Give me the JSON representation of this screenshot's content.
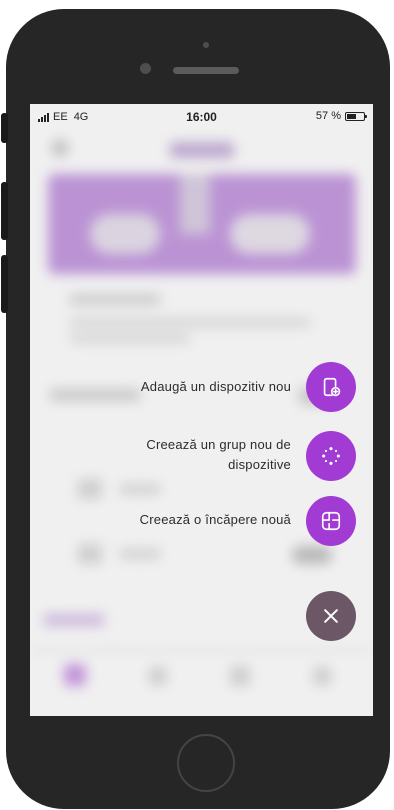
{
  "status_bar": {
    "carrier": "EE",
    "network": "4G",
    "time": "16:00",
    "battery_text": "57 %",
    "battery_level": 0.57
  },
  "speed_dial": {
    "add_device_label": "Adaugă un dispozitiv nou",
    "create_group_label_line1": "Creează un grup nou de",
    "create_group_label_line2": "dispozitive",
    "create_room_label": "Creează o încăpere nouă"
  },
  "colors": {
    "accent": "#a23bd3",
    "close_button": "#6c5767",
    "phone_frame": "#262626"
  }
}
